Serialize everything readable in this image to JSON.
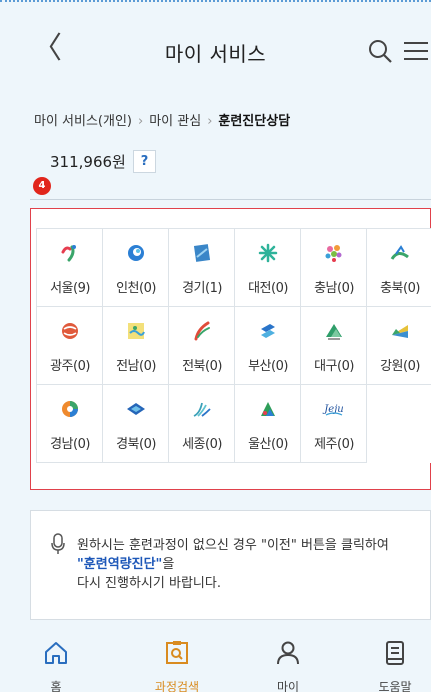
{
  "header": {
    "title": "마이 서비스",
    "back_label": "〈"
  },
  "breadcrumb": [
    "마이 서비스(개인)",
    "마이 관심",
    "훈련진단상담"
  ],
  "breadcrumb_sep": "›",
  "amount": {
    "value": "311,966원",
    "help_label": "?"
  },
  "step_badge": "4",
  "regions": [
    {
      "label": "서울(9)",
      "icon": "seoul-emblem-icon",
      "color": "#e63d4f"
    },
    {
      "label": "인천(0)",
      "icon": "incheon-emblem-icon",
      "color": "#2b7fd4"
    },
    {
      "label": "경기(1)",
      "icon": "gyeonggi-emblem-icon",
      "color": "#3a86c8"
    },
    {
      "label": "대전(0)",
      "icon": "daejeon-emblem-icon",
      "color": "#2fb39a"
    },
    {
      "label": "충남(0)",
      "icon": "chungnam-emblem-icon",
      "color": "#e86aa0"
    },
    {
      "label": "충북(0)",
      "icon": "chungbuk-emblem-icon",
      "color": "#3aa56a"
    },
    {
      "label": "광주(0)",
      "icon": "gwangju-emblem-icon",
      "color": "#e05a3c"
    },
    {
      "label": "전남(0)",
      "icon": "jeonnam-emblem-icon",
      "color": "#d9c033"
    },
    {
      "label": "전북(0)",
      "icon": "jeonbuk-emblem-icon",
      "color": "#e04b3a"
    },
    {
      "label": "부산(0)",
      "icon": "busan-emblem-icon",
      "color": "#2a74c9"
    },
    {
      "label": "대구(0)",
      "icon": "daegu-emblem-icon",
      "color": "#2f9e6a"
    },
    {
      "label": "강원(0)",
      "icon": "gangwon-emblem-icon",
      "color": "#3b8fd0"
    },
    {
      "label": "경남(0)",
      "icon": "gyeongnam-emblem-icon",
      "color": "#ef8a2e"
    },
    {
      "label": "경북(0)",
      "icon": "gyeongbuk-emblem-icon",
      "color": "#2566b8"
    },
    {
      "label": "세종(0)",
      "icon": "sejong-emblem-icon",
      "color": "#3aa0b8"
    },
    {
      "label": "울산(0)",
      "icon": "ulsan-emblem-icon",
      "color": "#2e9e58"
    },
    {
      "label": "제주(0)",
      "icon": "jeju-emblem-icon",
      "color": "#1d4f9c"
    }
  ],
  "jeju_logo_text": "Jeju",
  "notice": {
    "line1": "원하시는 훈련과정이 없으신 경우 \"이전\" 버튼을 클릭하여",
    "line2": "\"훈련역량진단\"",
    "line2_suffix": "을",
    "line3": "다시 진행하시기 바랍니다."
  },
  "bottom_nav": [
    {
      "label": "홈",
      "icon": "home-icon"
    },
    {
      "label": "과정검색",
      "icon": "course-search-icon"
    },
    {
      "label": "마이",
      "icon": "user-icon"
    },
    {
      "label": "도움말",
      "icon": "help-book-icon"
    }
  ],
  "colors": {
    "accent_blue": "#1d57b8",
    "badge_red": "#e1261c",
    "box_border": "#e0414b",
    "active_nav": "#d98b1f"
  }
}
